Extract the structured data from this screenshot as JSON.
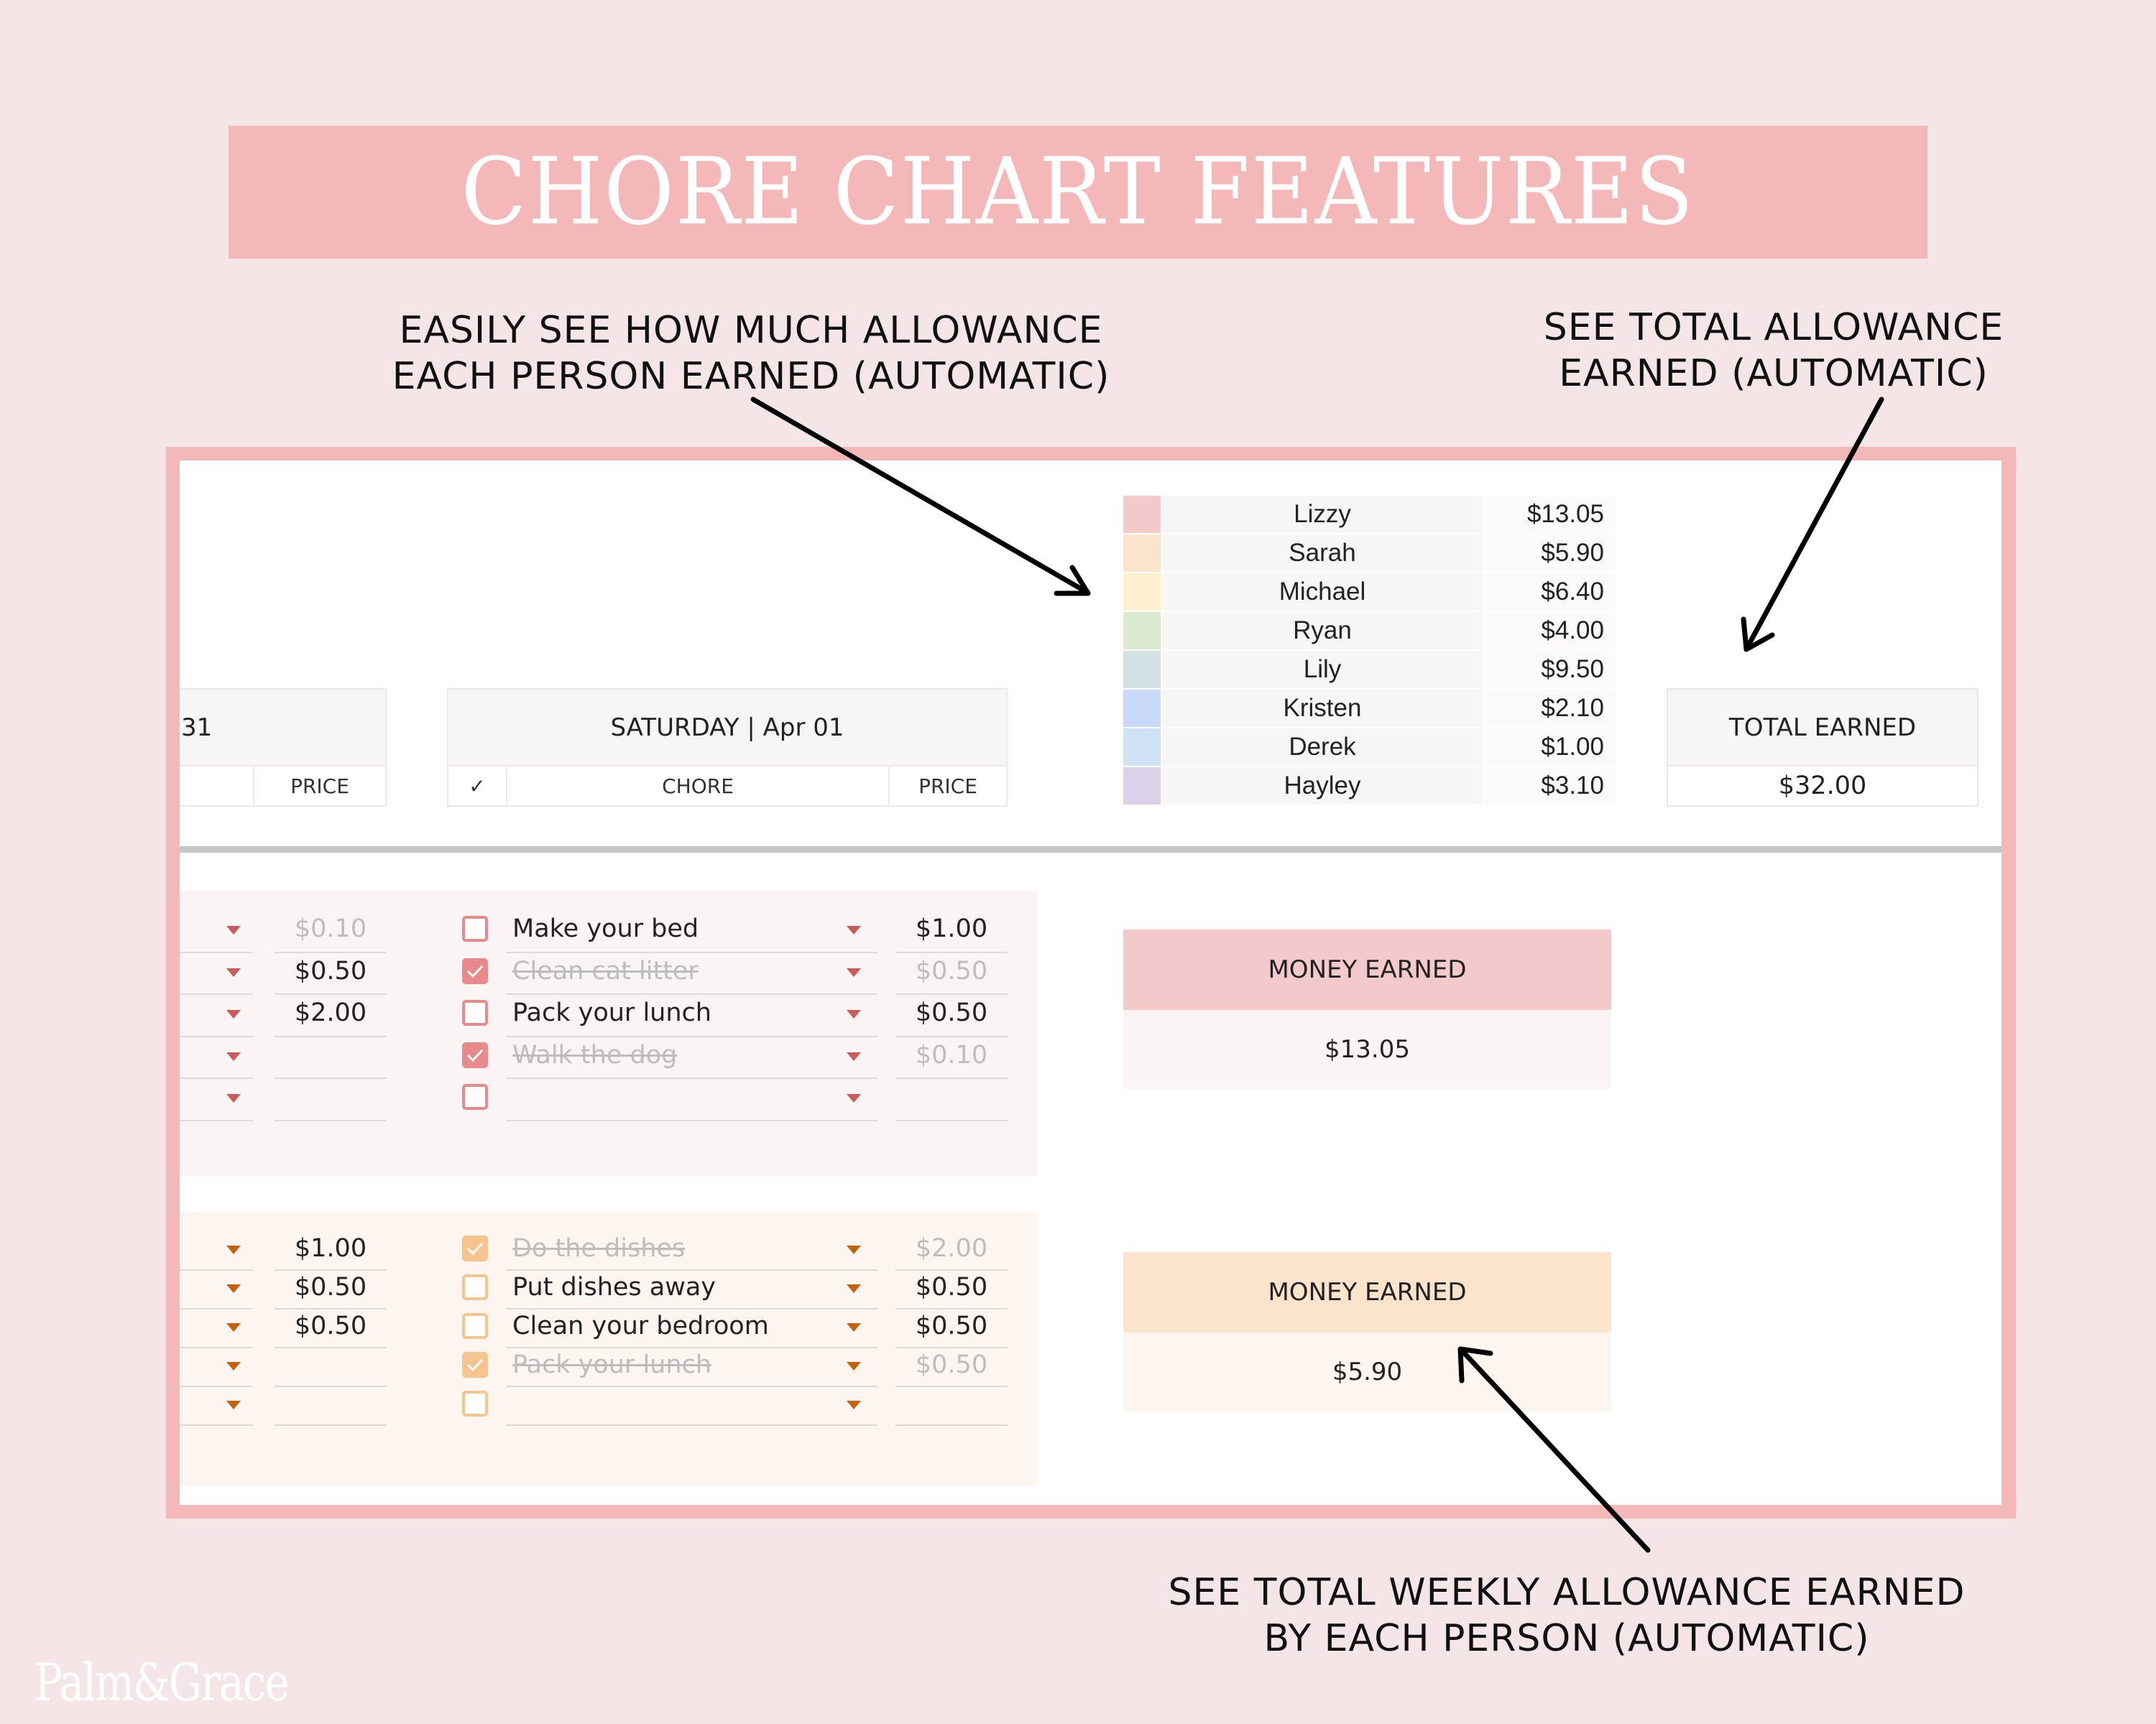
{
  "banner": {
    "title": "CHORE CHART FEATURES"
  },
  "callouts": {
    "per_person": [
      "EASILY SEE HOW MUCH ALLOWANCE",
      "EACH PERSON EARNED (AUTOMATIC)"
    ],
    "total": [
      "SEE TOTAL ALLOWANCE",
      "EARNED (AUTOMATIC)"
    ],
    "weekly": [
      "SEE TOTAL WEEKLY ALLOWANCE EARNED",
      "BY EACH PERSON (AUTOMATIC)"
    ]
  },
  "people": [
    {
      "name": "Lizzy",
      "amount": "$13.05",
      "color": "#f4c9cc"
    },
    {
      "name": "Sarah",
      "amount": "$5.90",
      "color": "#fce3cc"
    },
    {
      "name": "Michael",
      "amount": "$6.40",
      "color": "#fff1cf"
    },
    {
      "name": "Ryan",
      "amount": "$4.00",
      "color": "#d9eace"
    },
    {
      "name": "Lily",
      "amount": "$9.50",
      "color": "#d0e0e3"
    },
    {
      "name": "Kristen",
      "amount": "$2.10",
      "color": "#c9daf8"
    },
    {
      "name": "Derek",
      "amount": "$1.00",
      "color": "#cfe2f3"
    },
    {
      "name": "Hayley",
      "amount": "$3.10",
      "color": "#d9d2e9"
    }
  ],
  "prev_day": {
    "header_fragment": "31",
    "price_label": "PRICE"
  },
  "saturday": {
    "header": "SATURDAY | Apr 01",
    "check_label": "✓",
    "chore_label": "CHORE",
    "price_label": "PRICE"
  },
  "total_earned": {
    "label": "TOTAL EARNED",
    "value": "$32.00"
  },
  "sections": [
    {
      "person": "Lizzy",
      "accent": "#e8898b",
      "arrow_color": "#cc5a5a",
      "bg": "#fbf4f4",
      "money_hdr_bg": "#f4c9cc",
      "money_val_bg": "#fbf4f4",
      "money_label": "MONEY EARNED",
      "money_value": "$13.05",
      "prev_prices": [
        {
          "value": "$0.10",
          "done": true
        },
        {
          "value": "$0.50",
          "done": false
        },
        {
          "value": "$2.00",
          "done": false
        },
        {
          "value": "",
          "done": false
        },
        {
          "value": "",
          "done": false
        }
      ],
      "chores": [
        {
          "name": "Make your bed",
          "price": "$1.00",
          "done": false
        },
        {
          "name": "Clean cat litter",
          "price": "$0.50",
          "done": true
        },
        {
          "name": "Pack your lunch",
          "price": "$0.50",
          "done": false
        },
        {
          "name": "Walk the dog",
          "price": "$0.10",
          "done": true
        },
        {
          "name": "",
          "price": "",
          "done": false
        }
      ]
    },
    {
      "person": "Sarah",
      "accent": "#f6c48f",
      "arrow_color": "#c46210",
      "bg": "#fdf5ef",
      "money_hdr_bg": "#fce3cc",
      "money_val_bg": "#fdf5ef",
      "money_label": "MONEY EARNED",
      "money_value": "$5.90",
      "prev_prices": [
        {
          "value": "$1.00",
          "done": false
        },
        {
          "value": "$0.50",
          "done": false
        },
        {
          "value": "$0.50",
          "done": false
        },
        {
          "value": "",
          "done": false
        },
        {
          "value": "",
          "done": false
        }
      ],
      "chores": [
        {
          "name": "Do the dishes",
          "price": "$2.00",
          "done": true
        },
        {
          "name": "Put dishes away",
          "price": "$0.50",
          "done": false
        },
        {
          "name": "Clean your bedroom",
          "price": "$0.50",
          "done": false
        },
        {
          "name": "Pack your lunch",
          "price": "$0.50",
          "done": true
        },
        {
          "name": "",
          "price": "",
          "done": false
        }
      ]
    }
  ],
  "logo": {
    "text": "Palm&Grace"
  },
  "icons": {
    "check": "checkmark-icon",
    "dropdown": "dropdown-arrow-icon",
    "annotation_arrow": "arrow-icon"
  }
}
